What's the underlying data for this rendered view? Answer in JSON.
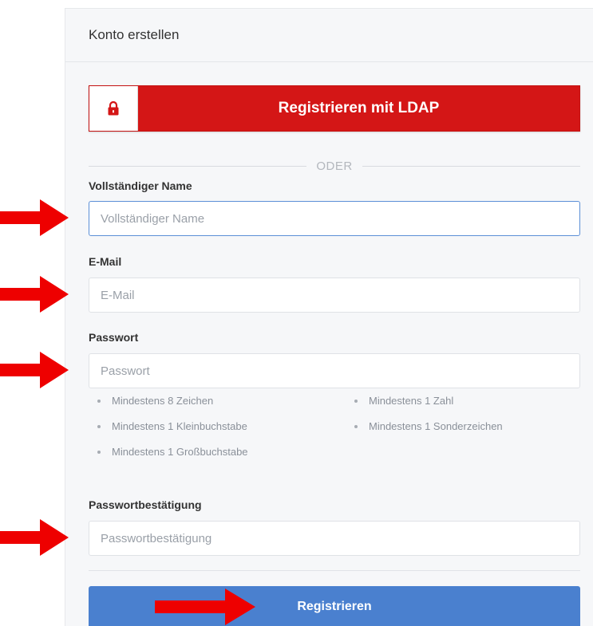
{
  "panel": {
    "title": "Konto erstellen"
  },
  "ldap": {
    "label": "Registrieren mit LDAP",
    "icon": "lock-icon"
  },
  "divider": {
    "text": "ODER"
  },
  "fields": {
    "full_name": {
      "label": "Vollständiger Name",
      "placeholder": "Vollständiger Name",
      "value": ""
    },
    "email": {
      "label": "E-Mail",
      "placeholder": "E-Mail",
      "value": ""
    },
    "password": {
      "label": "Passwort",
      "placeholder": "Passwort",
      "value": ""
    },
    "password_confirm": {
      "label": "Passwortbestätigung",
      "placeholder": "Passwortbestätigung",
      "value": ""
    }
  },
  "password_rules": [
    "Mindestens 8 Zeichen",
    "Mindestens 1 Zahl",
    "Mindestens 1 Kleinbuchstabe",
    "Mindestens 1 Sonderzeichen",
    "Mindestens 1 Großbuchstabe"
  ],
  "register": {
    "label": "Registrieren"
  },
  "colors": {
    "ldap_red": "#d41616",
    "register_blue": "#4a80cf",
    "arrow_red": "#ee0000",
    "focus_border": "#5b8fd6"
  }
}
